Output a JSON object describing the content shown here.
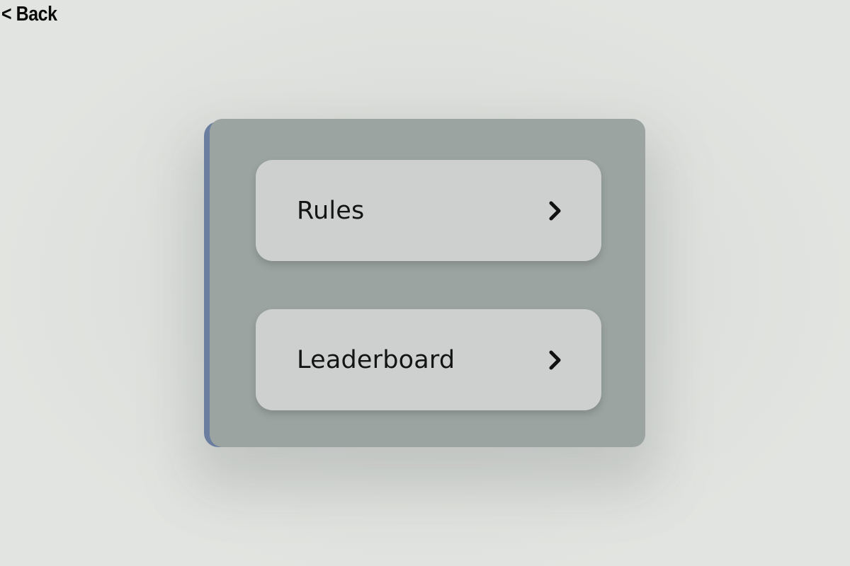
{
  "nav": {
    "back_label": "< Back"
  },
  "menu": {
    "items": [
      {
        "label": "Rules",
        "icon": "chevron-right-icon"
      },
      {
        "label": "Leaderboard",
        "icon": "chevron-right-icon"
      }
    ]
  },
  "colors": {
    "background": "#dbdeda",
    "card": "#9ba4a0",
    "card_edge": "#6c7ea0",
    "button": "#cdd0ce",
    "text": "#141414"
  }
}
